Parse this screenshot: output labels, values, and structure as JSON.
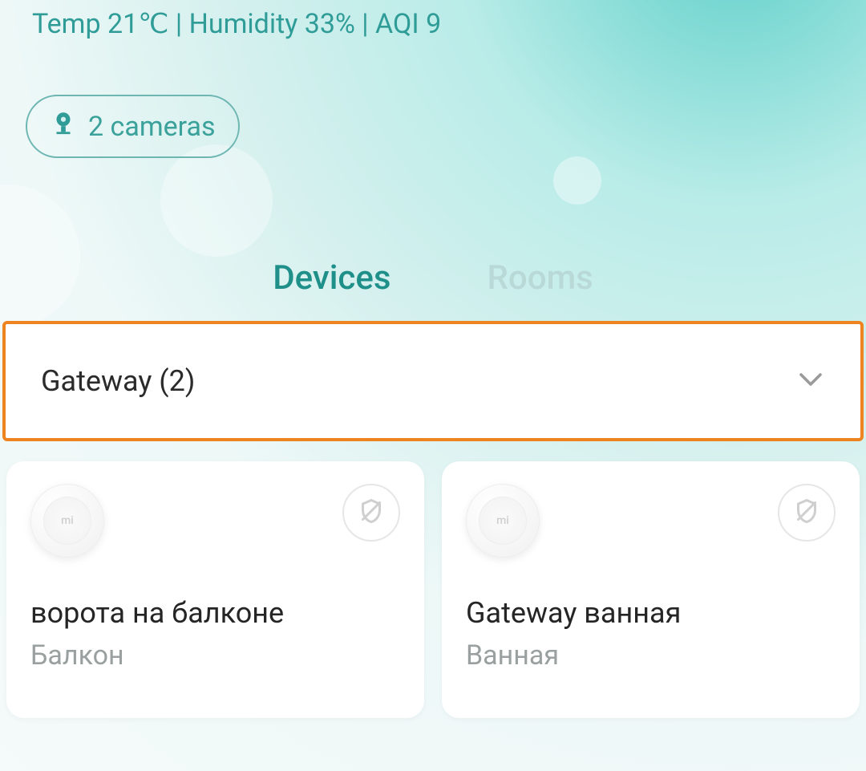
{
  "status": {
    "text": "Temp 21℃ | Humidity 33% | AQI 9"
  },
  "cameras": {
    "label": "2 cameras"
  },
  "tabs": {
    "devices": "Devices",
    "rooms": "Rooms"
  },
  "category": {
    "label": "Gateway (2)"
  },
  "devices": [
    {
      "name": "ворота на балконе",
      "room": "Балкон"
    },
    {
      "name": "Gateway ванная",
      "room": "Ванная"
    }
  ]
}
